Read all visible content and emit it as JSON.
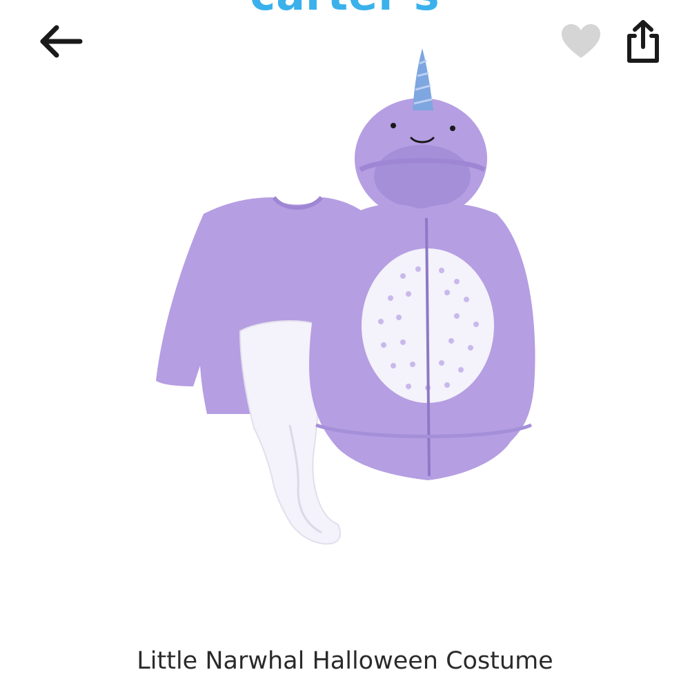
{
  "header": {
    "brand_name": "carter's",
    "back_icon": "arrow-left-icon",
    "favorite_icon": "heart-icon",
    "share_icon": "share-icon"
  },
  "product": {
    "title": "Little Narwhal Halloween Costume",
    "image_subject": "purple narwhal costume set"
  },
  "colors": {
    "brand": "#3bb1ec",
    "icon_dark": "#1a1a1a",
    "heart_inactive": "#d5d5d5",
    "costume_purple": "#b59ee2",
    "costume_light": "#f4f2fa"
  }
}
